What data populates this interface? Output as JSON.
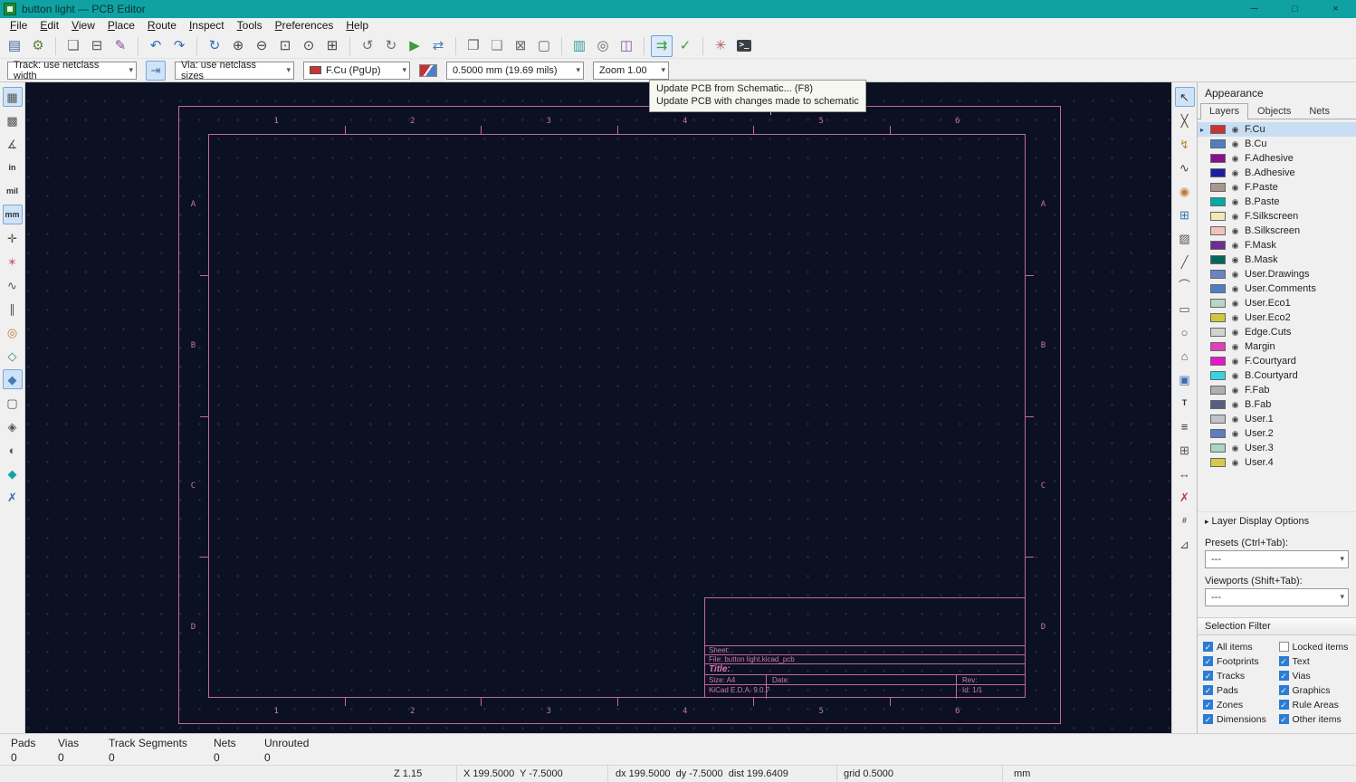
{
  "window": {
    "title": "button light — PCB Editor",
    "minimize": "─",
    "maximize": "□",
    "close": "×"
  },
  "menubar": {
    "items": [
      "File",
      "Edit",
      "View",
      "Place",
      "Route",
      "Inspect",
      "Tools",
      "Preferences",
      "Help"
    ]
  },
  "toolbar_main": {
    "items": [
      {
        "name": "save",
        "glyph": "▤",
        "color": "#44699c"
      },
      {
        "name": "board-setup",
        "glyph": "⚙",
        "color": "#5f7d3f"
      },
      {
        "sep": true
      },
      {
        "name": "page-settings",
        "glyph": "❏",
        "color": "#666666"
      },
      {
        "name": "print",
        "glyph": "⊟",
        "color": "#555555"
      },
      {
        "name": "plot",
        "glyph": "✎",
        "color": "#7e4f9e"
      },
      {
        "sep": true
      },
      {
        "name": "undo",
        "glyph": "↶",
        "color": "#2f6fbd"
      },
      {
        "name": "redo",
        "glyph": "↷",
        "color": "#2f6fbd"
      },
      {
        "sep": true
      },
      {
        "name": "refresh",
        "glyph": "↻",
        "color": "#2f6fbd"
      },
      {
        "name": "zoom-in",
        "glyph": "⊕",
        "color": "#454545"
      },
      {
        "name": "zoom-out",
        "glyph": "⊖",
        "color": "#454545"
      },
      {
        "name": "zoom-fit-page",
        "glyph": "⊡",
        "color": "#454545"
      },
      {
        "name": "zoom-fit-objects",
        "glyph": "⊙",
        "color": "#454545"
      },
      {
        "name": "zoom-selection",
        "glyph": "⊞",
        "color": "#454545"
      },
      {
        "sep": true
      },
      {
        "name": "rotate-ccw",
        "glyph": "↺",
        "color": "#6f6f6f"
      },
      {
        "name": "rotate-cw",
        "glyph": "↻",
        "color": "#6f6f6f"
      },
      {
        "name": "play",
        "glyph": "▶",
        "color": "#3d9c3d"
      },
      {
        "name": "mirror",
        "glyph": "⇄",
        "color": "#4a7ab5"
      },
      {
        "sep": true
      },
      {
        "name": "group",
        "glyph": "❐",
        "color": "#666666"
      },
      {
        "name": "ungroup",
        "glyph": "❏",
        "color": "#8a8a8a"
      },
      {
        "name": "lock",
        "glyph": "⊠",
        "color": "#666666"
      },
      {
        "name": "unlock",
        "glyph": "▢",
        "color": "#666666"
      },
      {
        "sep": true
      },
      {
        "name": "open-schematic",
        "glyph": "▥",
        "color": "#2a9d9d"
      },
      {
        "name": "footprint-search",
        "glyph": "◎",
        "color": "#666666"
      },
      {
        "name": "footprint-editor",
        "glyph": "◫",
        "color": "#8a5aa0"
      },
      {
        "sep": true
      },
      {
        "name": "update-pcb-from-schematic",
        "glyph": "⇉",
        "color": "#3d9c3d",
        "hover": true
      },
      {
        "name": "design-rules-check",
        "glyph": "✓",
        "color": "#3d9c3d"
      },
      {
        "sep": true
      },
      {
        "name": "footprint-wizard",
        "glyph": "✳",
        "color": "#b05a5a"
      },
      {
        "name": "scripting-console",
        "glyph": ">_",
        "color": "#ffffff",
        "bg": "#3a3f44",
        "text": true
      }
    ]
  },
  "toolbar_second": {
    "track": "Track: use netclass width",
    "auto_track_toggle_glyph": "⇥",
    "via": "Via: use netclass sizes",
    "layer": {
      "label": "F.Cu (PgUp)",
      "swatch": "#C83434"
    },
    "grid": "0.5000 mm (19.69 mils)",
    "zoom": "Zoom 1.00"
  },
  "tooltip": {
    "line1": "Update PCB from Schematic...  (F8)",
    "line2": "Update PCB with changes made to schematic"
  },
  "left_toolbar": {
    "items": [
      {
        "name": "show-grid",
        "glyph": "▦",
        "color": "#555555",
        "active": true
      },
      {
        "name": "grid-overrides",
        "glyph": "▩",
        "color": "#555555"
      },
      {
        "name": "polar-coordinates",
        "glyph": "∡",
        "color": "#555555"
      },
      {
        "name": "units-inches",
        "glyph": "in",
        "color": "#333333",
        "text": true
      },
      {
        "name": "units-mils",
        "glyph": "mil",
        "color": "#333333",
        "text": true
      },
      {
        "name": "units-mm",
        "glyph": "mm",
        "color": "#333333",
        "text": true,
        "active": true
      },
      {
        "name": "crosshair-shape",
        "glyph": "✛",
        "color": "#555555"
      },
      {
        "name": "show-ratsnest",
        "glyph": "✶",
        "color": "#c06a9a"
      },
      {
        "name": "curved-ratsnest",
        "glyph": "∿",
        "color": "#555555"
      },
      {
        "name": "track-outline-mode",
        "glyph": "∥",
        "color": "#555555"
      },
      {
        "name": "via-outline-mode",
        "glyph": "◎",
        "color": "#c07a3a"
      },
      {
        "name": "pad-outline-mode",
        "glyph": "◇",
        "color": "#3a8a5a"
      },
      {
        "name": "zone-fill-mode",
        "glyph": "◆",
        "color": "#4a7ab5",
        "active": true
      },
      {
        "name": "zone-outline-mode",
        "glyph": "▢",
        "color": "#555555"
      },
      {
        "name": "zone-fracture-mode",
        "glyph": "◈",
        "color": "#555555"
      },
      {
        "name": "dim-inactive-layers",
        "glyph": "◐",
        "color": "#555555"
      },
      {
        "name": "high-contrast-mode",
        "glyph": "◆",
        "color": "#12a5a5"
      },
      {
        "name": "flip-board-view",
        "glyph": "✗",
        "color": "#3a6db5"
      }
    ]
  },
  "right_toolbar": {
    "items": [
      {
        "name": "select-tool",
        "glyph": "↖",
        "color": "#333333",
        "active": true
      },
      {
        "name": "route-tracks",
        "glyph": "╳",
        "color": "#444444"
      },
      {
        "name": "highlight-net",
        "glyph": "↯",
        "color": "#b58a2a"
      },
      {
        "name": "local-ratsnest",
        "glyph": "∿",
        "color": "#444444"
      },
      {
        "name": "add-via",
        "glyph": "◉",
        "color": "#c07a3a"
      },
      {
        "name": "add-footprint",
        "glyph": "⊞",
        "color": "#3a6db5"
      },
      {
        "name": "add-zone",
        "glyph": "▨",
        "color": "#555555"
      },
      {
        "name": "draw-line",
        "glyph": "╱",
        "color": "#555555"
      },
      {
        "name": "draw-arc",
        "glyph": "⌒",
        "color": "#555555"
      },
      {
        "name": "draw-rectangle",
        "glyph": "▭",
        "color": "#555555"
      },
      {
        "name": "draw-circle",
        "glyph": "○",
        "color": "#555555"
      },
      {
        "name": "draw-polygon",
        "glyph": "⌂",
        "color": "#555555"
      },
      {
        "name": "add-image",
        "glyph": "▣",
        "color": "#3a6db5"
      },
      {
        "name": "add-text",
        "glyph": "T",
        "color": "#333333",
        "text": true
      },
      {
        "name": "add-textbox",
        "glyph": "≡",
        "color": "#333333"
      },
      {
        "name": "add-table",
        "glyph": "⊞",
        "color": "#555555"
      },
      {
        "name": "add-dimension",
        "glyph": "↔",
        "color": "#555555"
      },
      {
        "name": "delete-tool",
        "glyph": "✗",
        "color": "#c03a3a"
      },
      {
        "name": "grid-origin",
        "glyph": "#",
        "color": "#555555",
        "text": true
      },
      {
        "name": "measure-tool",
        "glyph": "⊿",
        "color": "#555555"
      }
    ]
  },
  "canvas": {
    "sheet": {
      "top_labels": [
        "1",
        "2",
        "3",
        "4",
        "5",
        "6"
      ],
      "side_labels": [
        "A",
        "B",
        "C",
        "D"
      ],
      "title_block": {
        "sheet_label": "Sheet:",
        "file": "File: button light.kicad_pcb",
        "title_label": "Title:",
        "size": "Size: A4",
        "date_label": "Date:",
        "rev_label": "Rev:",
        "version": "KiCad E.D.A. 9.0.7",
        "id": "Id: 1/1"
      }
    }
  },
  "appearance": {
    "title": "Appearance",
    "tabs": [
      "Layers",
      "Objects",
      "Nets"
    ],
    "selected_tab": "Layers",
    "selected_layer": "F.Cu",
    "layers": [
      {
        "name": "F.Cu",
        "color": "#C83434"
      },
      {
        "name": "B.Cu",
        "color": "#4D7FC4"
      },
      {
        "name": "F.Adhesive",
        "color": "#8B0E8B"
      },
      {
        "name": "B.Adhesive",
        "color": "#1C1C9E"
      },
      {
        "name": "F.Paste",
        "color": "#A5988C"
      },
      {
        "name": "B.Paste",
        "color": "#00AAAA"
      },
      {
        "name": "F.Silkscreen",
        "color": "#F0E9B6"
      },
      {
        "name": "B.Silkscreen",
        "color": "#F2C1B9"
      },
      {
        "name": "F.Mask",
        "color": "#6F2C91"
      },
      {
        "name": "B.Mask",
        "color": "#05665B"
      },
      {
        "name": "User.Drawings",
        "color": "#6C83C4"
      },
      {
        "name": "User.Comments",
        "color": "#4D7FC4"
      },
      {
        "name": "User.Eco1",
        "color": "#B5D8C5"
      },
      {
        "name": "User.Eco2",
        "color": "#CFC83B"
      },
      {
        "name": "Edge.Cuts",
        "color": "#D2D2CE"
      },
      {
        "name": "Margin",
        "color": "#E23FBD"
      },
      {
        "name": "F.Courtyard",
        "color": "#E816C9"
      },
      {
        "name": "B.Courtyard",
        "color": "#33D5E3"
      },
      {
        "name": "F.Fab",
        "color": "#AFAFAF"
      },
      {
        "name": "B.Fab",
        "color": "#585D84"
      },
      {
        "name": "User.1",
        "color": "#C2C4CC"
      },
      {
        "name": "User.2",
        "color": "#5C7CC4"
      },
      {
        "name": "User.3",
        "color": "#A9D6C6"
      },
      {
        "name": "User.4",
        "color": "#D4CB4C"
      }
    ],
    "layer_display_options": "Layer Display Options",
    "presets_label": "Presets (Ctrl+Tab):",
    "presets_value": "---",
    "viewports_label": "Viewports (Shift+Tab):",
    "viewports_value": "---"
  },
  "selection_filter": {
    "title": "Selection Filter",
    "items": [
      {
        "label": "All items",
        "checked": true
      },
      {
        "label": "Locked items",
        "checked": false
      },
      {
        "label": "Footprints",
        "checked": true
      },
      {
        "label": "Text",
        "checked": true
      },
      {
        "label": "Tracks",
        "checked": true
      },
      {
        "label": "Vias",
        "checked": true
      },
      {
        "label": "Pads",
        "checked": true
      },
      {
        "label": "Graphics",
        "checked": true
      },
      {
        "label": "Zones",
        "checked": true
      },
      {
        "label": "Rule Areas",
        "checked": true
      },
      {
        "label": "Dimensions",
        "checked": true
      },
      {
        "label": "Other items",
        "checked": true
      }
    ]
  },
  "statusbar": {
    "groups": [
      {
        "label": "Pads",
        "value": "0"
      },
      {
        "label": "Vias",
        "value": "0"
      },
      {
        "label": "Track Segments",
        "value": "0"
      },
      {
        "label": "Nets",
        "value": "0"
      },
      {
        "label": "Unrouted",
        "value": "0"
      }
    ]
  },
  "coordbar": {
    "zoom": "Z 1.15",
    "xy": "X 199.5000  Y -7.5000",
    "delta": "dx 199.5000  dy -7.5000  dist 199.6409",
    "grid": "grid 0.5000",
    "units": "mm"
  }
}
